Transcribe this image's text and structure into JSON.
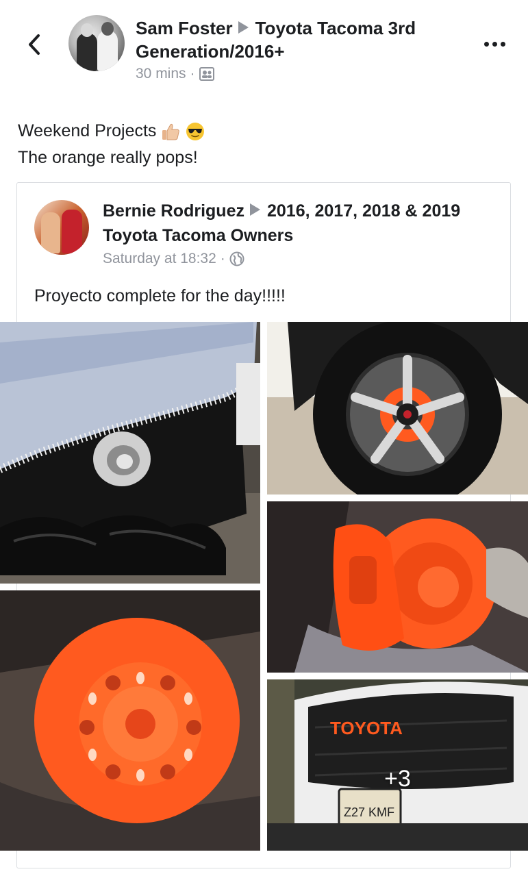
{
  "header": {
    "author": "Sam Foster",
    "group": "Toyota Tacoma 3rd Generation/2016+",
    "time": "30 mins",
    "separator": "·",
    "back_icon": "chevron-left-icon",
    "audience_icon": "group-icon",
    "more_icon": "more-dots-icon"
  },
  "post": {
    "line1": "Weekend Projects",
    "line1_emojis": [
      "thumbs-up-icon",
      "sunglasses-emoji-icon"
    ],
    "line2": "The orange really pops!"
  },
  "shared_post": {
    "author": "Bernie Rodriguez",
    "group": "2016, 2017, 2018 & 2019 Toyota Tacoma Owners",
    "time": "Saturday at 18:32",
    "separator": "·",
    "audience_icon": "globe-icon",
    "text": "Proyecto complete for the day!!!!!"
  },
  "photos": {
    "items": [
      {
        "name": "covered-truck-wheel-hub"
      },
      {
        "name": "wheel-with-orange-caliper"
      },
      {
        "name": "orange-painted-brake-caliper"
      },
      {
        "name": "orange-painted-brake-rotor"
      },
      {
        "name": "toyota-grille-orange-letters"
      }
    ],
    "grille_text": "TOYOTA",
    "plate_text": "Z27 KMF",
    "more_count": "+3"
  },
  "colors": {
    "accent_orange": "#ff5a1f",
    "meta_gray": "#90949c",
    "text": "#1c1e21",
    "border": "#dadde1"
  }
}
